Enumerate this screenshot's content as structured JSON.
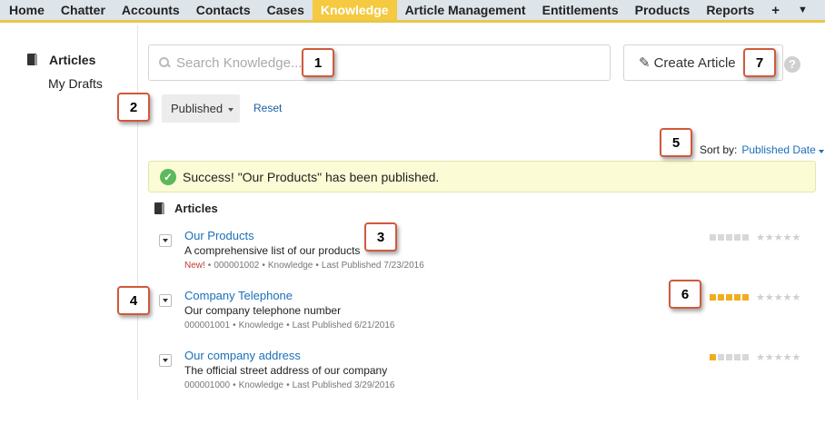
{
  "nav": {
    "tabs": [
      {
        "label": "Home"
      },
      {
        "label": "Chatter"
      },
      {
        "label": "Accounts"
      },
      {
        "label": "Contacts"
      },
      {
        "label": "Cases"
      },
      {
        "label": "Knowledge"
      },
      {
        "label": "Article Management"
      },
      {
        "label": "Entitlements"
      },
      {
        "label": "Products"
      },
      {
        "label": "Reports"
      }
    ],
    "plus_icon": "+",
    "more_icon": "▼",
    "active_color": "#f5c940"
  },
  "sidebar": {
    "articles_label": "Articles",
    "drafts_label": "My Drafts"
  },
  "search": {
    "placeholder": "Search Knowledge..."
  },
  "create_button": {
    "label": "Create Article"
  },
  "help_icon": "?",
  "filter": {
    "selected": "Published",
    "reset_label": "Reset"
  },
  "sort": {
    "label": "Sort by:",
    "value": "Published Date"
  },
  "banner": {
    "message": "Success! \"Our Products\" has been published."
  },
  "list": {
    "heading": "Articles",
    "articles": [
      {
        "title": "Our Products",
        "description": "A comprehensive list of our products",
        "new_label": "New!",
        "number": "000001002",
        "type": "Knowledge",
        "published": "Last Published 7/23/2016",
        "rating_level": 0
      },
      {
        "title": "Company Telephone",
        "description": "Our company telephone number",
        "new_label": "",
        "number": "000001001",
        "type": "Knowledge",
        "published": "Last Published 6/21/2016",
        "rating_level": 5
      },
      {
        "title": "Our company address",
        "description": "The official street address of our company",
        "new_label": "",
        "number": "000001000",
        "type": "Knowledge",
        "published": "Last Published 3/29/2016",
        "rating_level": 1
      }
    ]
  },
  "callouts": [
    "1",
    "2",
    "3",
    "4",
    "5",
    "6",
    "7"
  ],
  "colors": {
    "link": "#1b6fb8",
    "rating_on": "#f0ad1e",
    "callout_border": "#d05a3c",
    "banner_bg": "#fbfbd5"
  }
}
